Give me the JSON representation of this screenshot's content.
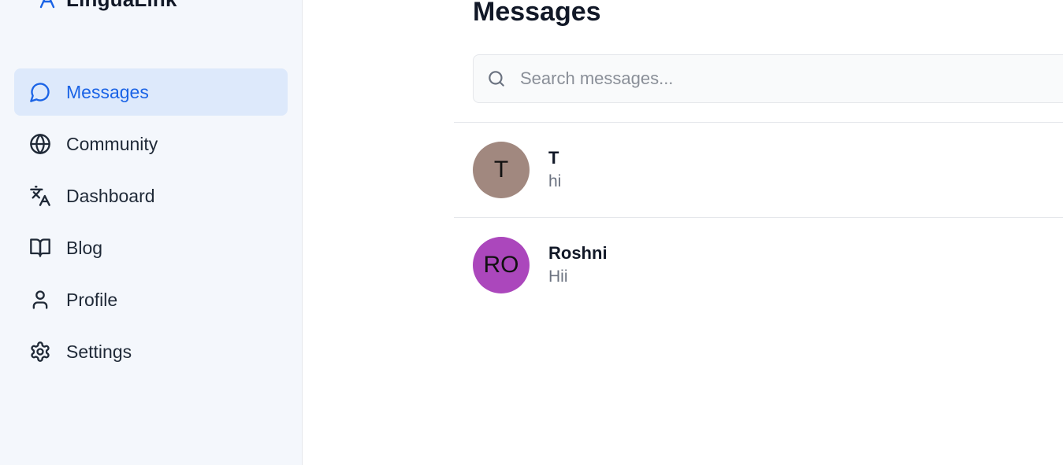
{
  "app": {
    "name": "LinguaLink"
  },
  "sidebar": {
    "items": [
      {
        "label": "Messages",
        "icon": "message-circle-icon",
        "active": true
      },
      {
        "label": "Community",
        "icon": "globe-icon",
        "active": false
      },
      {
        "label": "Dashboard",
        "icon": "translate-icon",
        "active": false
      },
      {
        "label": "Blog",
        "icon": "book-open-icon",
        "active": false
      },
      {
        "label": "Profile",
        "icon": "user-icon",
        "active": false
      },
      {
        "label": "Settings",
        "icon": "gear-icon",
        "active": false
      }
    ]
  },
  "main": {
    "title": "Messages",
    "search": {
      "placeholder": "Search messages...",
      "value": ""
    },
    "conversations": [
      {
        "initials": "T",
        "name": "T",
        "preview": "hi",
        "avatar_color": "#a1887f"
      },
      {
        "initials": "RO",
        "name": "Roshni",
        "preview": "Hii",
        "avatar_color": "#ab47bc"
      }
    ]
  },
  "colors": {
    "accent": "#1a63e6",
    "active_bg": "#dde9fb",
    "sidebar_bg": "#f4f7fc"
  }
}
